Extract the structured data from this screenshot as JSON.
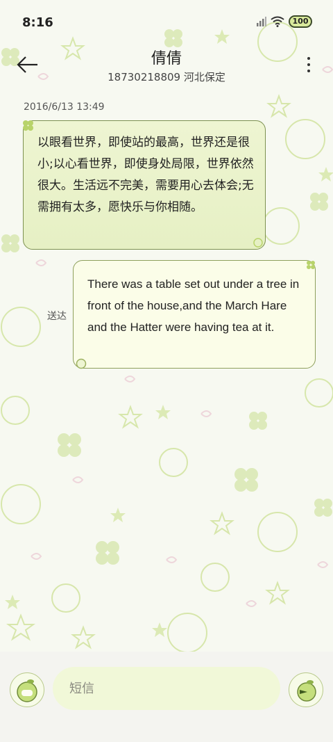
{
  "status_bar": {
    "time": "8:16",
    "battery": "100"
  },
  "header": {
    "contact_name": "倩倩",
    "contact_sub": "18730218809 河北保定"
  },
  "thread": {
    "timestamp": "2016/6/13 13:49",
    "incoming_message": "以眼看世界，即使站的最高，世界还是很小;以心看世界，即使身处局限，世界依然很大。生活远不完美，需要用心去体会;无需拥有太多，愿快乐与你相随。",
    "outgoing_status": "送达",
    "outgoing_message": "There was a table set out under a tree in front of the house,and the March Hare and the Hatter were having tea at it."
  },
  "composer": {
    "placeholder": "短信"
  },
  "colors": {
    "accent": "#b8d36a",
    "bubble_border": "#7d9150",
    "background": "#f7f9f1"
  },
  "icons": {
    "back": "arrow-left-icon",
    "more": "more-vertical-icon",
    "attach": "apple-sticker-icon",
    "send": "send-apple-icon"
  }
}
